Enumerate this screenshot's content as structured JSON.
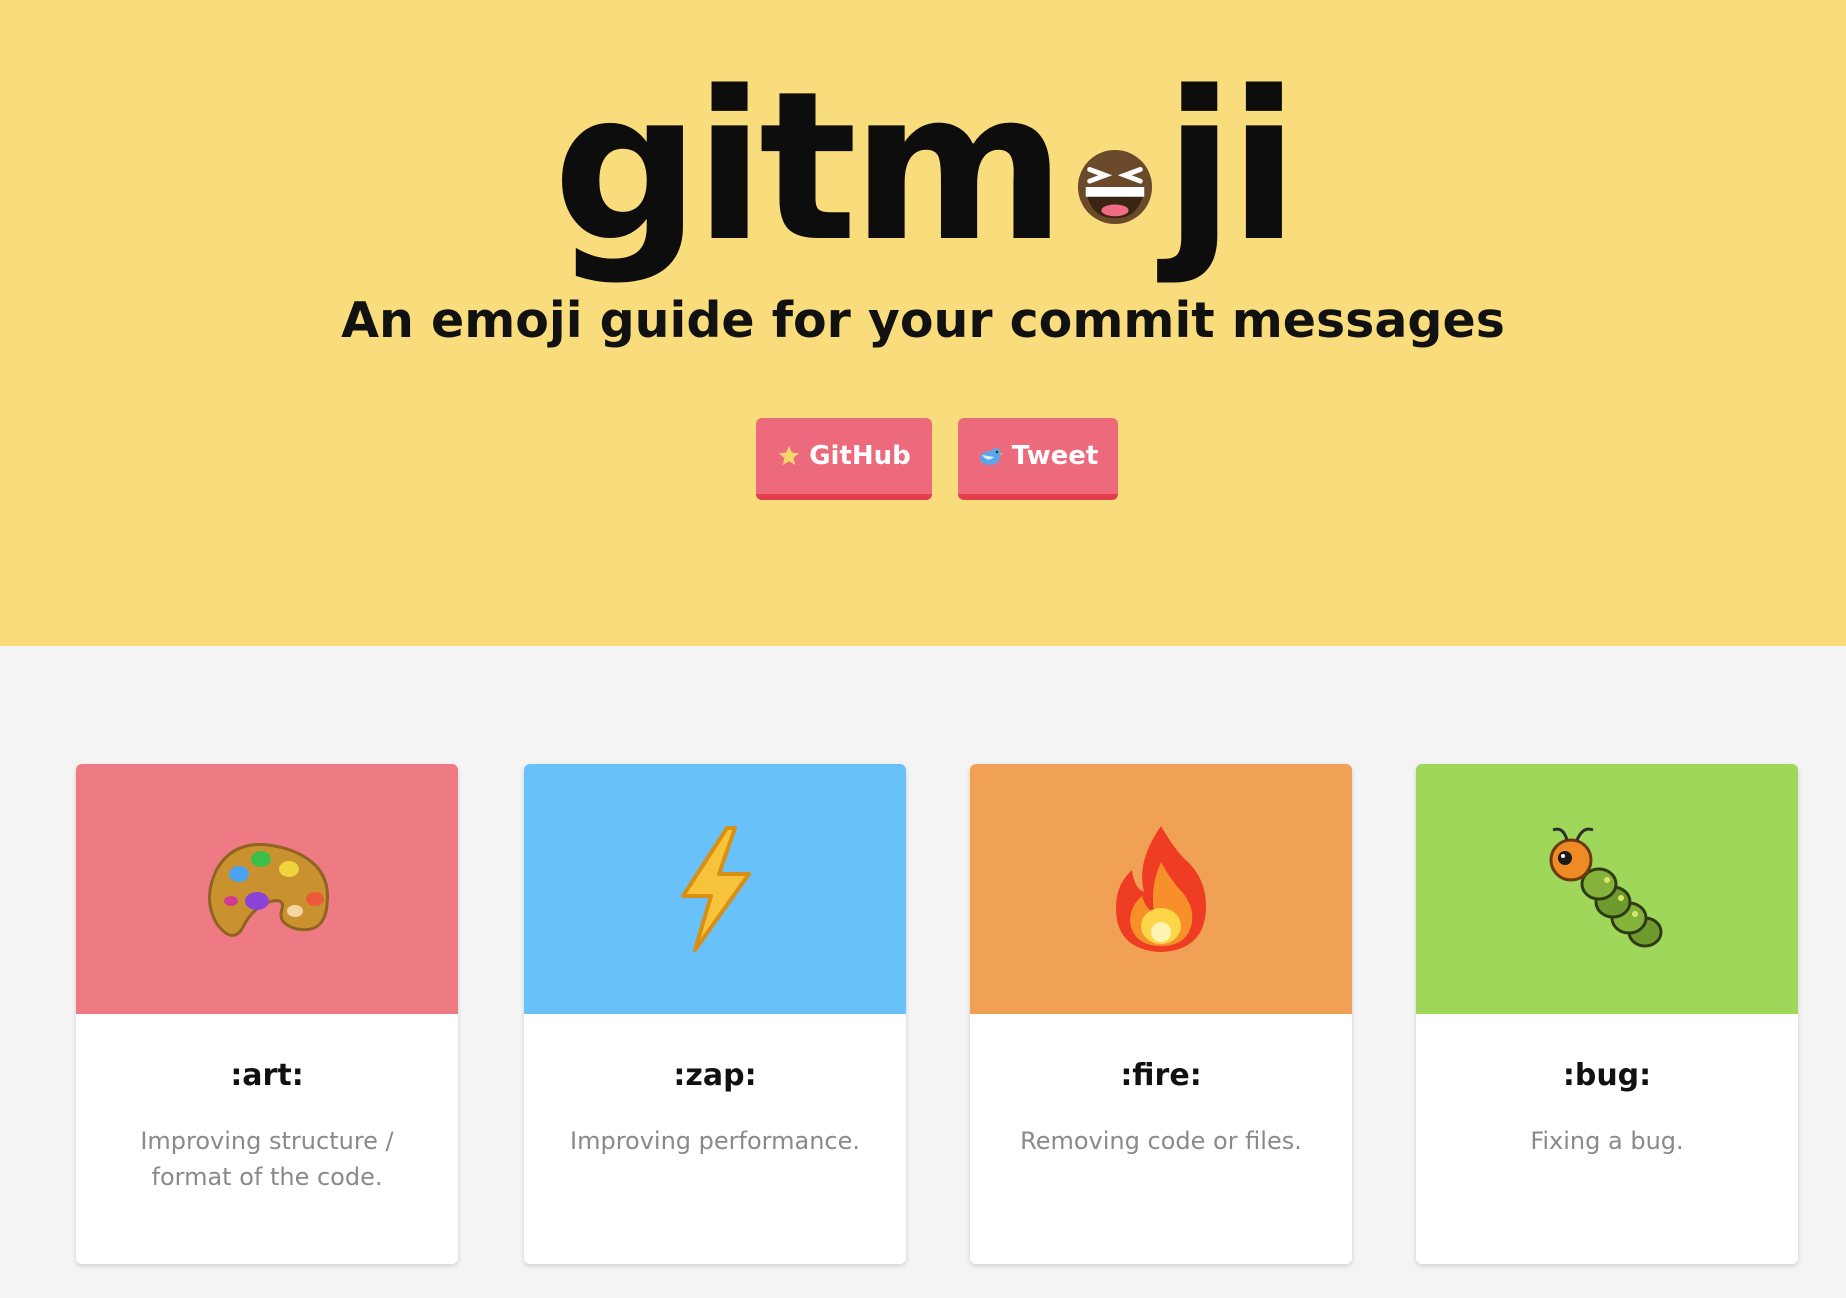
{
  "header": {
    "logo_left": "gitm",
    "logo_right": "ji",
    "logo_emoji": "grinning-squinting-face-icon",
    "tagline": "An emoji guide for your commit messages",
    "background": "#f9dd7c"
  },
  "buttons": [
    {
      "label": "GitHub",
      "icon": "star-icon"
    },
    {
      "label": "Tweet",
      "icon": "bird-icon"
    }
  ],
  "button_color": "#ec6a7c",
  "cards": [
    {
      "code": ":art:",
      "description": "Improving structure / format of the code.",
      "emoji": "palette-icon",
      "color": "#ee7a84"
    },
    {
      "code": ":zap:",
      "description": "Improving performance.",
      "emoji": "lightning-icon",
      "color": "#68c1f8"
    },
    {
      "code": ":fire:",
      "description": "Removing code or files.",
      "emoji": "fire-icon",
      "color": "#f0a156"
    },
    {
      "code": ":bug:",
      "description": "Fixing a bug.",
      "emoji": "bug-icon",
      "color": "#9fd75a"
    }
  ]
}
